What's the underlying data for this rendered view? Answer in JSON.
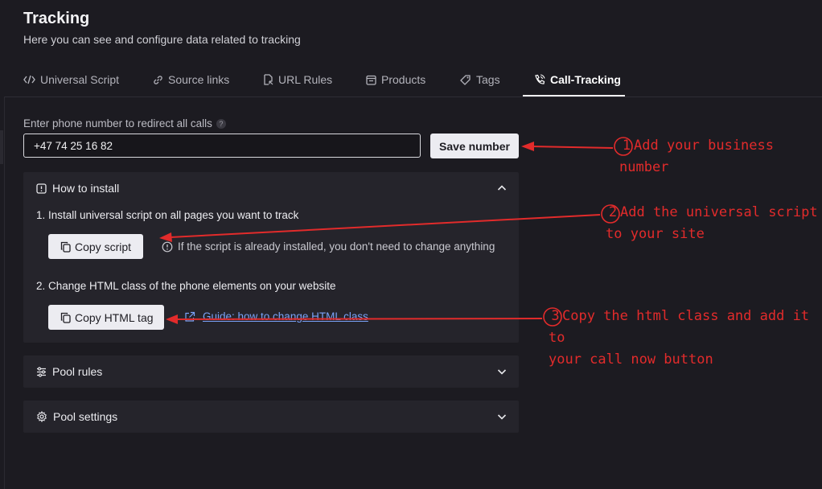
{
  "header": {
    "title": "Tracking",
    "subtitle": "Here you can see and configure data related to tracking"
  },
  "tabs": [
    {
      "label": "Universal Script",
      "icon": "code-icon"
    },
    {
      "label": "Source links",
      "icon": "link-icon"
    },
    {
      "label": "URL Rules",
      "icon": "url-rules-icon"
    },
    {
      "label": "Products",
      "icon": "products-icon"
    },
    {
      "label": "Tags",
      "icon": "tag-icon"
    },
    {
      "label": "Call-Tracking",
      "icon": "phone-call-icon",
      "active": true
    }
  ],
  "phone": {
    "label": "Enter phone number to redirect all calls",
    "help_glyph": "?",
    "value": "+47 74 25 16 82",
    "save_label": "Save number"
  },
  "install": {
    "title": "How to install",
    "expanded": true,
    "step1": "1. Install universal script on all pages you want to track",
    "copy_script_label": "Copy script",
    "note": "If the script is already installed, you don't need to change anything",
    "step2": "2. Change HTML class of the phone elements on your website",
    "copy_html_label": "Copy HTML tag",
    "guide_link": "Guide: how to change HTML class"
  },
  "pool_rules": {
    "title": "Pool rules",
    "expanded": false
  },
  "pool_settings": {
    "title": "Pool settings",
    "expanded": false
  },
  "annotations": [
    {
      "number": "1",
      "line1": "Add your business",
      "line2": "number"
    },
    {
      "number": "2",
      "line1": "Add the universal script",
      "line2": "to your site"
    },
    {
      "number": "3",
      "line1": "Copy the html class and add it to",
      "line2": "your call now button"
    }
  ],
  "colors": {
    "background": "#1c1b21",
    "panel": "#25242b",
    "button": "#ececf1",
    "link": "#7aa2f7",
    "annotation": "#e22b2b"
  }
}
